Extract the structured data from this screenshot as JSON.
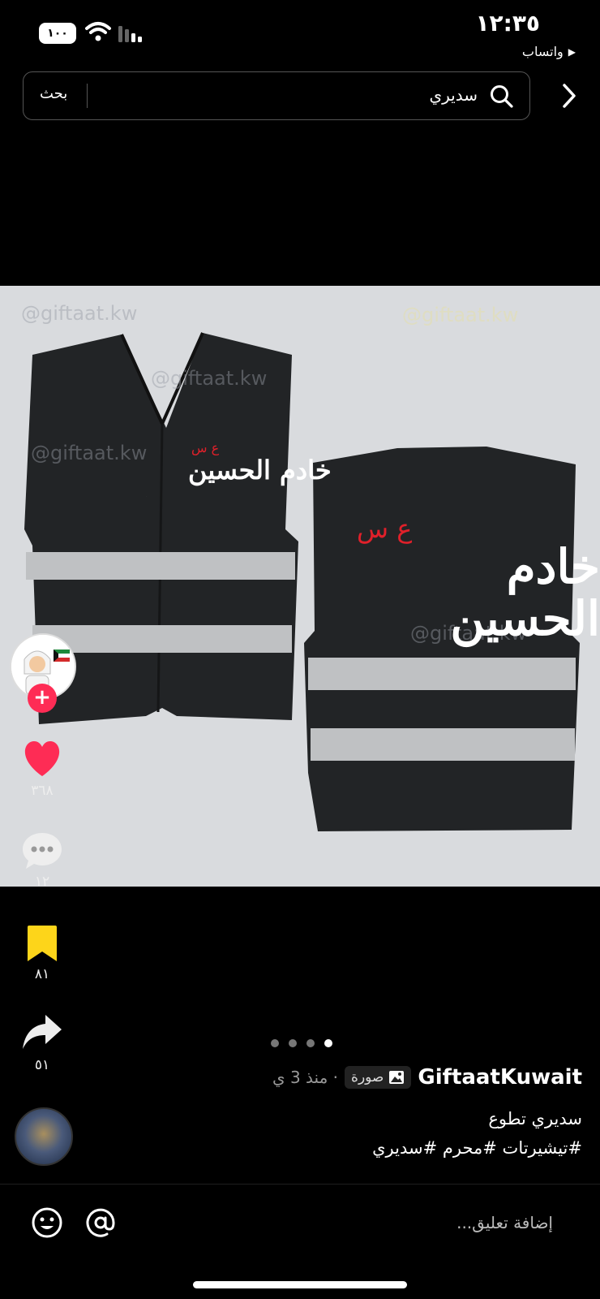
{
  "status_bar": {
    "time": "١٢:٣٥",
    "battery": "١٠٠",
    "back_app": "واتساب"
  },
  "search": {
    "query": "سديري",
    "button_label": "بحث"
  },
  "media": {
    "watermark": "@giftaat.kw",
    "vest_text_main": "خادم الحسين",
    "vest_text_mark": "ع س",
    "page_count": 4,
    "current_page": 4
  },
  "actions": {
    "likes": "٣٦٨",
    "comments": "١٢",
    "saves": "٨١",
    "shares": "٥١",
    "colors": {
      "like": "#fe2c55",
      "save": "#fdd51a",
      "follow": "#fe2c55"
    }
  },
  "post": {
    "author": "GiftaatKuwait",
    "type_label": "صورة",
    "time": "· منذ 3 ي",
    "caption_line1": "سديري تطوع",
    "caption_line2": "#تيشيرتات #محرم #سديري"
  },
  "comment_bar": {
    "placeholder": "إضافة تعليق..."
  }
}
